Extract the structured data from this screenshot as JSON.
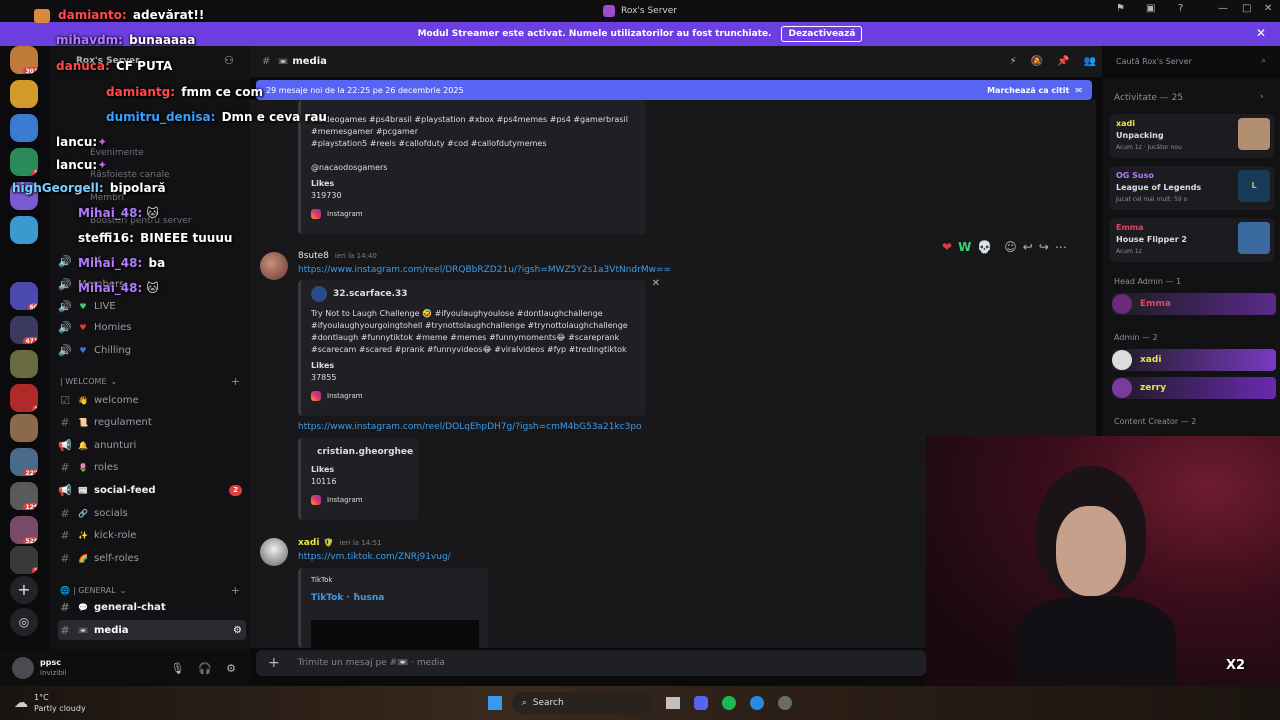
{
  "window": {
    "title": "Rox's Server"
  },
  "streamer_bar": {
    "text": "Modul Streamer este activat. Numele utilizatorilor au fost trunchiate.",
    "button": "Dezactivează"
  },
  "server_badges": [
    "301",
    "3",
    "60",
    "471",
    "1",
    "222",
    "129",
    "528",
    "2"
  ],
  "sidebar": {
    "server_name": "Rox's Server",
    "menu_items": [
      "Evenimente",
      "Răsfoiește canale",
      "Membri",
      "Boosturi pentru server"
    ],
    "voice": [
      {
        "label": "verif"
      },
      {
        "label": "Members:"
      },
      {
        "label": "LIVE"
      },
      {
        "label": "Homies"
      },
      {
        "label": "Chilling"
      }
    ],
    "categories": {
      "welcome": "| WELCOME",
      "general": "| GENERAL"
    },
    "channels": [
      {
        "label": "welcome",
        "emoji": "👋"
      },
      {
        "label": "regulament",
        "emoji": "📜"
      },
      {
        "label": "anunturi",
        "emoji": "🔔"
      },
      {
        "label": "roles",
        "emoji": "🌷"
      },
      {
        "label": "social-feed",
        "emoji": "📰",
        "badge": "2"
      },
      {
        "label": "socials",
        "emoji": "🔗"
      },
      {
        "label": "kick-role",
        "emoji": "✨"
      },
      {
        "label": "self-roles",
        "emoji": "🌈"
      }
    ],
    "general_channels": [
      {
        "label": "general-chat",
        "emoji": "💬"
      },
      {
        "label": "media",
        "emoji": "📼"
      }
    ]
  },
  "user": {
    "name": "ppsc",
    "status": "Invizibil"
  },
  "header": {
    "channel": "media"
  },
  "search": {
    "placeholder": "Caută Rox's Server"
  },
  "new_messages": {
    "text": "29 mesaje noi de la 22:25 pe 26 decembrie 2025",
    "action": "Marchează ca citit"
  },
  "messages": {
    "embed1": {
      "lines": [
        "#videogames #ps4brasil #playstation #xbox #ps4memes #ps4 #gamerbrasil",
        "#memesgamer #pcgamer",
        "#playstation5 #reels #callofduty #cod #callofdutymemes",
        "@nacaodosgamers"
      ],
      "likes_label": "Likes",
      "likes": "319730",
      "provider": "Instagram"
    },
    "msg2": {
      "author": "8sute8",
      "time": "ieri la 14:40",
      "link": "https://www.instagram.com/reel/DRQBbRZD21u/?igsh=MWZ5Y2s1a3VtNndrMw==",
      "embed_author": "32.scarface.33",
      "lines": [
        "Try Not to Laugh Challenge 🤣 #ifyoulaughyoulose #dontlaughchallenge",
        "#ifyoulaughyourgoingtohell #trynottolaughchallenge #trynottolaughchallenge",
        "#dontlaugh #funnytiktok #meme #memes #funnymoments😂 #scareprank",
        "#scarecam #scared #prank #funnyvideos😂 #viralvideos #fyp #tredingtiktok"
      ],
      "likes_label": "Likes",
      "likes": "37855",
      "provider": "Instagram"
    },
    "msg3": {
      "link": "https://www.instagram.com/reel/DOLqEhpDH7g/?igsh=cmM4bG53a21kc3po",
      "embed_author": "cristian.gheorghee",
      "likes_label": "Likes",
      "likes": "10116",
      "provider": "Instagram"
    },
    "msg4": {
      "author": "xadi",
      "time": "ieri la 14:51",
      "link": "https://vm.tiktok.com/ZNRj91vug/",
      "provider": "TikTok",
      "title": "TikTok · ħusna"
    }
  },
  "reactions": [
    "❤",
    "W",
    "💀"
  ],
  "composer": {
    "placeholder": "Trimite un mesaj pe #📼 · media"
  },
  "members": {
    "activity_title": "Activitate — 25",
    "activities": [
      {
        "user": "xadi",
        "game": "Unpacking",
        "detail": "Acum 1z · Jucător nou"
      },
      {
        "user": "OG Suso",
        "game": "League of Legends",
        "detail": "Jucat cel mai mult: 59 o"
      },
      {
        "user": "Emma",
        "game": "House Flipper 2",
        "detail": "Acum 1z"
      }
    ],
    "groups": [
      {
        "title": "Head Admin — 1",
        "members": [
          {
            "name": "Emma",
            "color": "#e0455a"
          }
        ]
      },
      {
        "title": "Admin — 2",
        "members": [
          {
            "name": "xadi",
            "color": "#e6e64a"
          },
          {
            "name": "zerry",
            "color": "#e6e64a"
          }
        ]
      },
      {
        "title": "Content Creator — 2",
        "members": []
      }
    ]
  },
  "overlay_chat": [
    {
      "user": "damianto:",
      "msg": "adevărat!!",
      "color": "#ff4a4a"
    },
    {
      "user": "mihavdm:",
      "msg": "bunaaaaa",
      "color": "#b27bff"
    },
    {
      "user": "danuca:",
      "msg": "CF PUTA",
      "color": "#ff4a4a"
    },
    {
      "user": "damiantg:",
      "msg": "fmm ce com",
      "color": "#ff4a4a"
    },
    {
      "user": "dumitru_denisa:",
      "msg": "Dmn e ceva rau",
      "color": "#3aa0ff"
    },
    {
      "user": "lancu:",
      "msg": "",
      "color": "#ffffff"
    },
    {
      "user": "lancu:",
      "msg": "",
      "color": "#ffffff"
    },
    {
      "user": "highGeorgell:",
      "msg": "bipolară",
      "color": "#7ad0ff"
    },
    {
      "user": "Mihai_48:",
      "msg": "",
      "color": "#b27bff"
    },
    {
      "user": "steffi16:",
      "msg": "BINEEE tuuuu",
      "color": "#ffffff"
    },
    {
      "user": "Mihai_48:",
      "msg": "ba",
      "color": "#b27bff"
    },
    {
      "user": "Mihai_48:",
      "msg": "",
      "color": "#b27bff"
    }
  ],
  "taskbar": {
    "temp": "1°C",
    "weather": "Partly cloudy",
    "search": "Search"
  },
  "cam_badge": "X2"
}
